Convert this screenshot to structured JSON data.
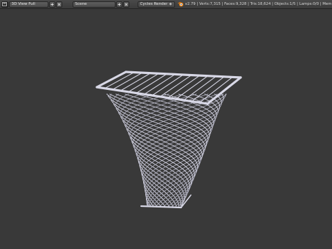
{
  "header": {
    "screen_layout": "3D View Full",
    "scene": "Scene",
    "render_engine": "Cycles Render",
    "stats": "v2.79 | Verts:7,315 | Faces:9,328 | Tris:18,624 | Objects:1/5 | Lamps:0/0 | Mem:58.64M | Plane"
  },
  "icons": {
    "editor_type": "info-icon",
    "add": "plus-icon",
    "remove": "close-icon",
    "logo": "blender-logo-icon"
  },
  "colors": {
    "viewport_bg": "#393939",
    "header_bg": "#4a4a4a",
    "mesh_wire": "#d8d8e6",
    "mesh_shadow": "#8a8a9a"
  }
}
